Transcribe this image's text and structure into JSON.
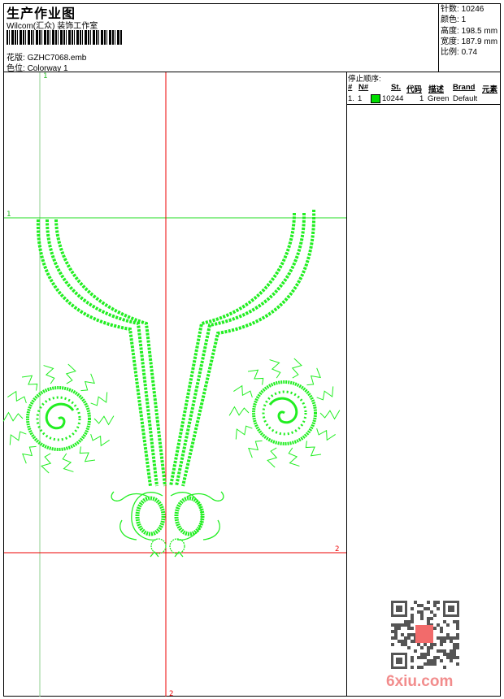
{
  "header": {
    "title": "生产作业图",
    "company": "Wilcom(汇众) 装饰工作室",
    "design_label": "花版:",
    "design_value": "GZHC7068.emb",
    "colorway_label": "色位:",
    "colorway_value": "Colorway 1"
  },
  "info": {
    "stitches_label": "针数:",
    "stitches_value": "10246",
    "colors_label": "颜色:",
    "colors_value": "1",
    "height_label": "高度:",
    "height_value": "198.5 mm",
    "width_label": "宽度:",
    "width_value": "187.9 mm",
    "scale_label": "比例:",
    "scale_value": "0.74"
  },
  "stop_sequence": {
    "title": "停止顺序:",
    "columns": [
      "#",
      "N#",
      "St.",
      "代码",
      "描述",
      "Brand",
      "元素"
    ],
    "rows": [
      {
        "index": "1.",
        "n": "1",
        "swatch": "#00dd00",
        "stitches": "10244",
        "code": "1",
        "description": "Green",
        "brand": "Default"
      }
    ]
  },
  "canvas": {
    "guide_v1_label": "1",
    "guide_h1_label": "1",
    "guide_h2_label": "2",
    "guide_v2_label": "2",
    "thread_color": "#22ee22",
    "guide_green": "#22dd22",
    "guide_red": "#ee0000"
  },
  "watermark": {
    "text": "6xiu.com"
  }
}
